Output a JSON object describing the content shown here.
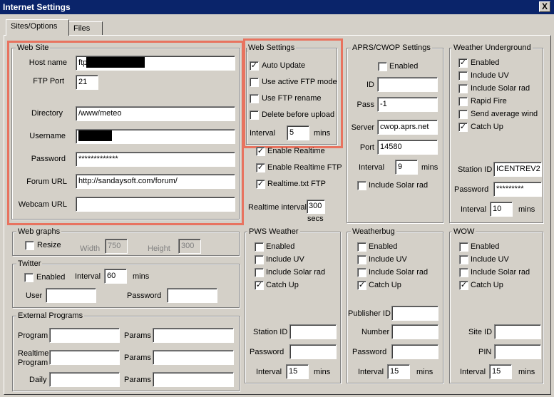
{
  "window": {
    "title": "Internet Settings",
    "close_glyph": "X"
  },
  "tabs": [
    {
      "label": "Sites/Options"
    },
    {
      "label": "Files"
    }
  ],
  "website": {
    "legend": "Web Site",
    "host_label": "Host name",
    "host_value": "ftp",
    "port_label": "FTP Port",
    "port_value": "21",
    "directory_label": "Directory",
    "directory_value": "/www/meteo",
    "username_label": "Username",
    "password_label": "Password",
    "password_value": "*************",
    "forum_label": "Forum URL",
    "forum_value": "http://sandaysoft.com/forum/",
    "webcam_label": "Webcam URL",
    "webcam_value": ""
  },
  "websettings": {
    "legend": "Web Settings",
    "auto_update": "Auto Update",
    "active_ftp": "Use active FTP mode",
    "ftp_rename": "Use FTP rename",
    "delete_before": "Delete before upload",
    "interval_label": "Interval",
    "interval_value": "5",
    "interval_unit": "mins"
  },
  "realtime": {
    "enable_realtime": "Enable Realtime",
    "enable_realtime_ftp": "Enable Realtime FTP",
    "realtime_txt": "Realtime.txt FTP",
    "interval_label": "Realtime interval",
    "interval_value": "300",
    "interval_unit": "secs"
  },
  "aprs": {
    "legend": "APRS/CWOP Settings",
    "enabled": "Enabled",
    "id_label": "ID",
    "id_value": "",
    "pass_label": "Pass",
    "pass_value": "-1",
    "server_label": "Server",
    "server_value": "cwop.aprs.net",
    "port_label": "Port",
    "port_value": "14580",
    "interval_label": "Interval",
    "interval_value": "9",
    "interval_unit": "mins",
    "solar": "Include Solar rad"
  },
  "wunderground": {
    "legend": "Weather Underground",
    "enabled": "Enabled",
    "uv": "Include UV",
    "solar": "Include Solar rad",
    "rapid": "Rapid Fire",
    "send_avg": "Send average wind",
    "catchup": "Catch Up",
    "station_label": "Station ID",
    "station_value": "ICENTREV2",
    "password_label": "Password",
    "password_value": "*********",
    "interval_label": "Interval",
    "interval_value": "10",
    "interval_unit": "mins"
  },
  "webgraphs": {
    "legend": "Web graphs",
    "resize": "Resize",
    "width_label": "Width",
    "width_value": "750",
    "height_label": "Height",
    "height_value": "300"
  },
  "twitter": {
    "legend": "Twitter",
    "enabled": "Enabled",
    "interval_label": "Interval",
    "interval_value": "60",
    "interval_unit": "mins",
    "user_label": "User",
    "user_value": "",
    "password_label": "Password",
    "password_value": ""
  },
  "external": {
    "legend": "External Programs",
    "program_label": "Program",
    "params_label": "Params",
    "realtime_label": "Realtime Program",
    "daily_label": "Daily"
  },
  "pws": {
    "legend": "PWS Weather",
    "enabled": "Enabled",
    "uv": "Include UV",
    "solar": "Include Solar rad",
    "catchup": "Catch Up",
    "station_label": "Station ID",
    "password_label": "Password",
    "interval_label": "Interval",
    "interval_value": "15",
    "interval_unit": "mins"
  },
  "weatherbug": {
    "legend": "Weatherbug",
    "enabled": "Enabled",
    "uv": "Include UV",
    "solar": "Include Solar rad",
    "catchup": "Catch Up",
    "publisher_label": "Publisher ID",
    "number_label": "Number",
    "password_label": "Password",
    "interval_label": "Interval",
    "interval_value": "15",
    "interval_unit": "mins"
  },
  "wow": {
    "legend": "WOW",
    "enabled": "Enabled",
    "uv": "Include UV",
    "solar": "Include Solar rad",
    "catchup": "Catch Up",
    "site_label": "Site ID",
    "pin_label": "PIN",
    "interval_label": "Interval",
    "interval_value": "15",
    "interval_unit": "mins"
  },
  "check_glyph": "✓"
}
